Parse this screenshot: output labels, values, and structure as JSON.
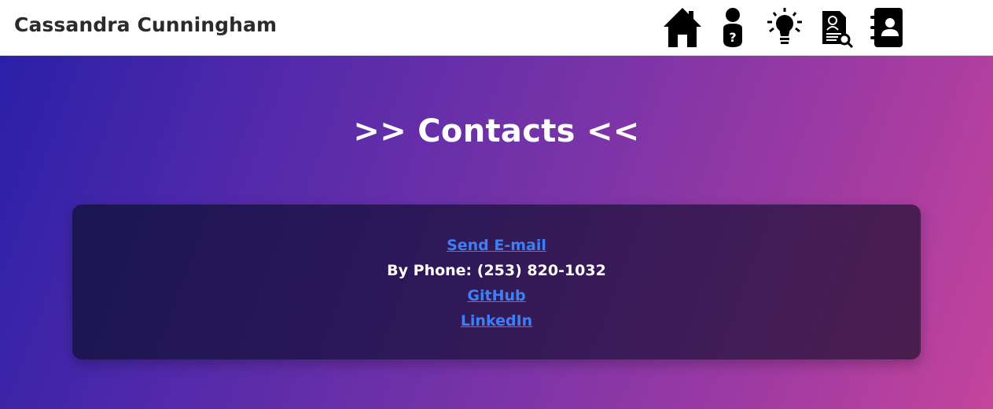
{
  "header": {
    "brand": "Cassandra Cunningham",
    "icons": [
      {
        "name": "home-icon"
      },
      {
        "name": "about-me-icon"
      },
      {
        "name": "lightbulb-icon"
      },
      {
        "name": "resume-icon"
      },
      {
        "name": "contacts-icon"
      }
    ]
  },
  "main": {
    "title": ">> Contacts <<",
    "contacts": {
      "email_label": "Send E-mail",
      "phone_text": "By Phone: (253) 820-1032",
      "github_label": "GitHub",
      "linkedin_label": "LinkedIn"
    }
  },
  "colors": {
    "link": "#3d80f5",
    "title": "#ffffff",
    "gradient_start": "#2a20a8",
    "gradient_end": "#c4449c"
  }
}
